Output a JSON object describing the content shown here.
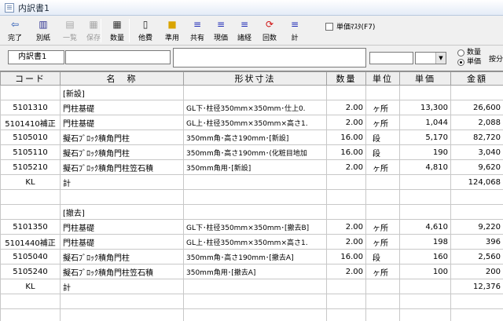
{
  "window": {
    "title": "内訳書1"
  },
  "toolbar": {
    "buttons": [
      {
        "label": "完了",
        "icon": "arrow-left-icon",
        "enabled": true
      },
      {
        "label": "別紙",
        "icon": "document-icon",
        "enabled": true
      },
      {
        "label": "一覧",
        "icon": "list-icon",
        "enabled": false
      },
      {
        "label": "保存",
        "icon": "save-icon",
        "enabled": false
      },
      {
        "label": "数量",
        "icon": "table-icon",
        "enabled": true
      },
      {
        "label": "他費",
        "icon": "page-icon",
        "enabled": true
      },
      {
        "label": "準用",
        "icon": "folder-icon",
        "enabled": true
      },
      {
        "label": "共有",
        "icon": "lines-icon",
        "enabled": true
      },
      {
        "label": "現価",
        "icon": "lines-icon",
        "enabled": true
      },
      {
        "label": "諸経",
        "icon": "lines-icon",
        "enabled": true
      },
      {
        "label": "回数",
        "icon": "refresh-icon",
        "enabled": true
      },
      {
        "label": "計",
        "icon": "lines-icon",
        "enabled": true
      }
    ],
    "tanka_checkbox_label": "単価ﾏｽﾀ(F7)"
  },
  "inputs": {
    "tab_label": "内訳書1",
    "radio_options": [
      "数量",
      "単価"
    ],
    "radio_selected": "単価",
    "anbun_label": "按分"
  },
  "table": {
    "headers": [
      "コード",
      "名　称",
      "形状寸法",
      "数量",
      "単位",
      "単価",
      "金額"
    ],
    "rows": [
      [
        "",
        "[新設]",
        "",
        "",
        "",
        "",
        ""
      ],
      [
        "5101310",
        "門柱基礎",
        "GL下･柱径350mm×350mm･仕上0.",
        "2.00",
        "ヶ所",
        "13,300",
        "26,600"
      ],
      [
        "5101410補正",
        "門柱基礎",
        "GL上･柱径350mm×350mm×高さ1.",
        "2.00",
        "ヶ所",
        "1,044",
        "2,088"
      ],
      [
        "5105010",
        "擬石ﾌﾞﾛｯｸ積角門柱",
        "350mm角･高さ190mm･[新設]",
        "16.00",
        "段",
        "5,170",
        "82,720"
      ],
      [
        "5105110",
        "擬石ﾌﾞﾛｯｸ積角門柱",
        "350mm角･高さ190mm･(化粧目地加",
        "16.00",
        "段",
        "190",
        "3,040"
      ],
      [
        "5105210",
        "擬石ﾌﾞﾛｯｸ積角門柱笠石積",
        "350mm角用･[新設]",
        "2.00",
        "ヶ所",
        "4,810",
        "9,620"
      ],
      [
        "KL",
        "計",
        "",
        "",
        "",
        "",
        "124,068"
      ],
      [
        "",
        "",
        "",
        "",
        "",
        "",
        ""
      ],
      [
        "",
        "[撤去]",
        "",
        "",
        "",
        "",
        ""
      ],
      [
        "5101350",
        "門柱基礎",
        "GL下･柱径350mm×350mm･[撤去B]",
        "2.00",
        "ヶ所",
        "4,610",
        "9,220"
      ],
      [
        "5101440補正",
        "門柱基礎",
        "GL上･柱径350mm×350mm×高さ1.",
        "2.00",
        "ヶ所",
        "198",
        "396"
      ],
      [
        "5105040",
        "擬石ﾌﾞﾛｯｸ積角門柱",
        "350mm角･高さ190mm･[撤去A]",
        "16.00",
        "段",
        "160",
        "2,560"
      ],
      [
        "5105240",
        "擬石ﾌﾞﾛｯｸ積角門柱笠石積",
        "350mm角用･[撤去A]",
        "2.00",
        "ヶ所",
        "100",
        "200"
      ],
      [
        "KL",
        "計",
        "",
        "",
        "",
        "",
        "12,376"
      ],
      [
        "",
        "",
        "",
        "",
        "",
        "",
        ""
      ],
      [
        "",
        "",
        "",
        "",
        "",
        "",
        ""
      ]
    ]
  }
}
